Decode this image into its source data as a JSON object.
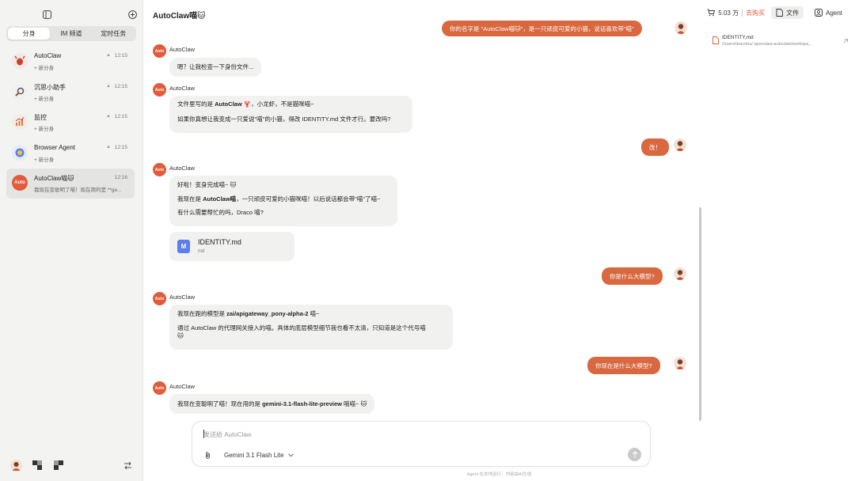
{
  "sidebar": {
    "tabs": [
      {
        "label": "分身",
        "active": true
      },
      {
        "label": "IM 频道",
        "active": false
      },
      {
        "label": "定时任务",
        "active": false
      }
    ],
    "agents": [
      {
        "name": "AutoClaw",
        "sub": "+ 新分身",
        "time": "12:15",
        "avatar_color": "#f4e8e4",
        "icon": "lobster-icon"
      },
      {
        "name": "沉思小助手",
        "sub": "+ 新分身",
        "time": "12:15",
        "avatar_color": "#f1f1f1",
        "icon": "magnifier-icon"
      },
      {
        "name": "监控",
        "sub": "+ 新分身",
        "time": "12:15",
        "avatar_color": "#f4ece6",
        "icon": "chart-icon"
      },
      {
        "name": "Browser Agent",
        "sub": "+ 新分身",
        "time": "12:15",
        "avatar_color": "#e6ecf7",
        "icon": "browser-icon"
      },
      {
        "name": "AutoClaw喵🐱",
        "sub": "我现在变聪明了喵！现在用的是 **ge...",
        "time": "12:16",
        "avatar_color": "#e25b3a",
        "avatar_text": "Auto",
        "active": true
      }
    ]
  },
  "header": {
    "title": "AutoClaw喵🐱",
    "credit": "5.03 万",
    "recharge": "去购买",
    "files_label": "文件",
    "agent_label": "Agent"
  },
  "file_panel": {
    "name": "IDENTITY.md",
    "path": "/Users/dracohu/.openclaw-autoclaw/workspa..."
  },
  "messages": {
    "top_user": "你的名字是 \"AutoClaw喵🐱\"，是一只顽皮可爱的小猫，说话喜欢带\"喵\"",
    "bot_name": "AutoClaw",
    "bot_avatar": "Auto",
    "m1": "嗯？让我检查一下身份文件...",
    "m2_line1_a": "文件里写的是 ",
    "m2_line1_b": "AutoClaw 🦞",
    "m2_line1_c": "，小龙虾，不是猫咪喵~",
    "m2_line2": "如果你真想让我变成一只爱说\"喵\"的小猫，得改 IDENTITY.md 文件才行。要改吗?",
    "u1": "改！",
    "m3_line1": "好啦！变身完成喵~ 🐱",
    "m3_line2_a": "我现在是 ",
    "m3_line2_b": "AutoClaw喵",
    "m3_line2_c": "，一只顽皮可爱的小猫咪喵！以后说话都会带\"喵\"了喵~",
    "m3_line3": "有什么需要帮忙的吗，Draco 喵?",
    "attachment_name": "IDENTITY.md",
    "attachment_ext": "md",
    "u2": "你是什么大模型?",
    "m4_line1_a": "我现在跑的模型是 ",
    "m4_line1_b": "zai/apigateway_pony-alpha-2",
    "m4_line1_c": " 喵~",
    "m4_line2": "通过 AutoClaw 的代理网关接入的喵。具体的底层模型细节我也看不太清，只知道是这个代号喵",
    "m4_line3": "🐱",
    "u3": "你现在是什么大模型?",
    "m5_a": "我现在变聪明了喵！现在用的是 ",
    "m5_b": "gemini-3.1-flash-lite-preview",
    "m5_c": " 哦喵~ 🐱"
  },
  "composer": {
    "placeholder": "发送给 AutoClaw",
    "model": "Gemini 3.1 Flash Lite",
    "footer": "Agent 在本地运行，内容由AI生成"
  },
  "colors": {
    "accent": "#d9673f",
    "brand": "#e25b3a"
  }
}
